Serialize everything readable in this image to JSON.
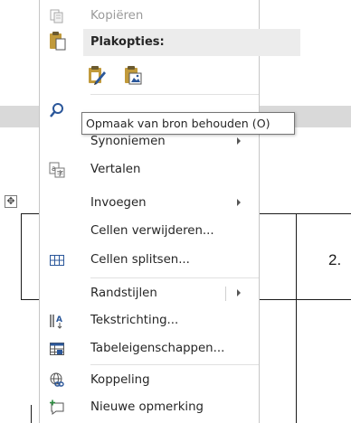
{
  "menu": {
    "copy_label": "Kopiëren",
    "paste_options_label": "Plakopties:",
    "synonyms_label": "Synoniemen",
    "translate_label": "Vertalen",
    "insert_label": "Invoegen",
    "delete_cells_label": "Cellen verwijderen...",
    "split_cells_label": "Cellen splitsen...",
    "border_styles_label": "Randstijlen",
    "text_direction_label": "Tekstrichting...",
    "table_properties_label": "Tabeleigenschappen...",
    "link_label": "Koppeling",
    "new_comment_label": "Nieuwe opmerking"
  },
  "tooltip": {
    "text": "Opmaak van bron behouden (O)"
  },
  "document": {
    "cell_text": "2."
  },
  "icons": {
    "copy": "copy-icon",
    "paste_header": "clipboard-paste-icon",
    "keep_source_formatting": "keep-source-formatting-icon",
    "picture_paste": "paste-as-picture-icon",
    "smart_lookup": "smart-lookup-icon",
    "translate": "translate-icon",
    "split_cells": "split-cells-icon",
    "text_direction": "text-direction-icon",
    "table_properties": "table-properties-icon",
    "link": "link-icon",
    "new_comment": "new-comment-icon",
    "table_move_handle": "table-move-handle-icon"
  },
  "colors": {
    "accent_blue": "#2b579a",
    "section_header_bg": "#ececec",
    "disabled_text": "#9a9a9a",
    "paste_icon_gold": "#c19a3b"
  }
}
